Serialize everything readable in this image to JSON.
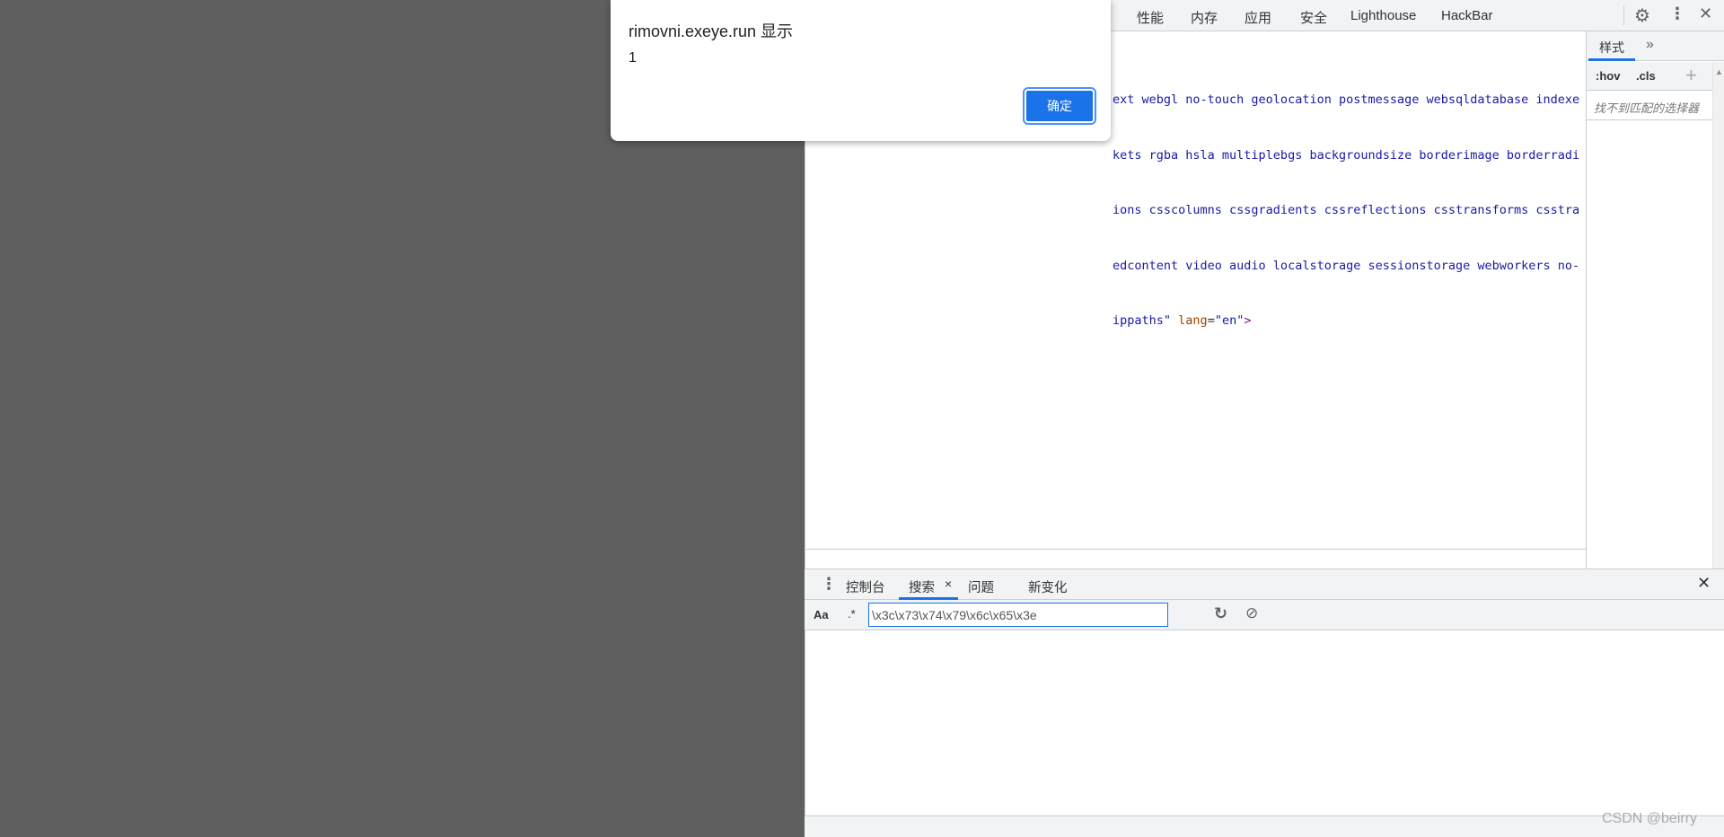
{
  "dialog": {
    "title": "rimovni.exeye.run 显示",
    "message": "1",
    "ok_label": "确定"
  },
  "devtools": {
    "tabs": [
      "性能",
      "内存",
      "应用",
      "安全",
      "Lighthouse",
      "HackBar"
    ],
    "code_lines": [
      "ext webgl no-touch geolocation postmessage websqldatabase indexe",
      "kets rgba hsla multiplebgs backgroundsize borderimage borderradi",
      "ions csscolumns cssgradients cssreflections csstransforms csstra",
      "edcontent video audio localstorage sessionstorage webworkers no-"
    ],
    "last_line": {
      "value_end": "ippaths\"",
      "attr": "lang",
      "eq": "=",
      "attr_value": "\"en\"",
      "close": ">"
    },
    "styles": {
      "tab": "样式",
      "more": "»",
      "hov": ":hov",
      "cls": ".cls",
      "add": "+",
      "empty": "找不到匹配的选择器"
    },
    "drawer": {
      "tabs": [
        "控制台",
        "搜索",
        "问题",
        "新变化"
      ],
      "active_tab": "搜索",
      "case_label": "Aa",
      "regex_label": ".*",
      "search_value": "\\x3c\\x73\\x74\\x79\\x6c\\x65\\x3e"
    }
  },
  "watermark": "CSDN @beirry",
  "colors": {
    "page_bg": "#5f5f5f",
    "accent": "#1a73e8",
    "code_value": "#1a1aa6",
    "attr_name": "#994500"
  }
}
